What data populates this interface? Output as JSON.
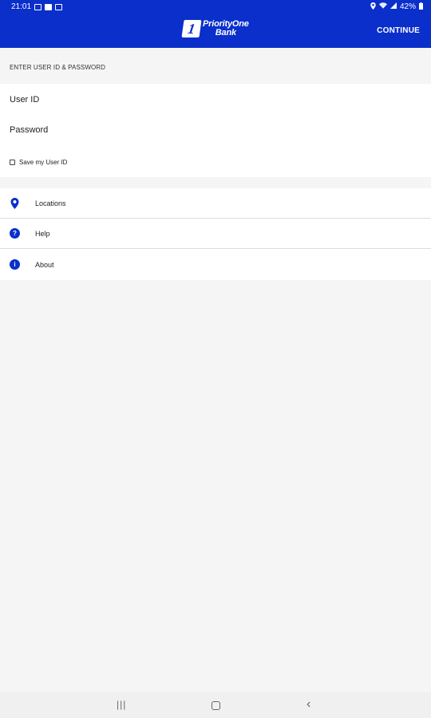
{
  "status_bar": {
    "time": "21:01",
    "battery": "42%"
  },
  "app_bar": {
    "logo_line1": "PriorityOne",
    "logo_line2": "Bank",
    "logo_mark": "1",
    "continue_label": "CONTINUE"
  },
  "login": {
    "section_title": "ENTER USER ID & PASSWORD",
    "user_id_placeholder": "User ID",
    "password_placeholder": "Password",
    "save_user_id_label": "Save my User ID",
    "save_user_id_checked": false
  },
  "menu": {
    "items": [
      {
        "label": "Locations",
        "icon": "location-pin-icon"
      },
      {
        "label": "Help",
        "icon": "help-icon",
        "glyph": "?"
      },
      {
        "label": "About",
        "icon": "info-icon",
        "glyph": "i"
      }
    ]
  },
  "nav_bar": {
    "recent_glyph": "|||",
    "back_glyph": "‹"
  },
  "colors": {
    "brand": "#0a2fcb",
    "background": "#f5f5f5"
  }
}
